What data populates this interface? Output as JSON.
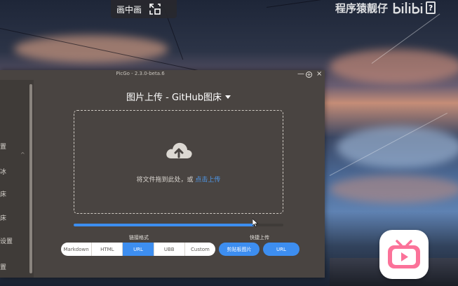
{
  "overlay": {
    "pip_label": "画中画",
    "watermark": "程序猿靓仔",
    "watermark_logo": "bilibili",
    "bili_badge": "?"
  },
  "window": {
    "title": "PicGo - 2.3.0-beta.6",
    "controls": {
      "minimize": "—",
      "maximize": "+",
      "close": "×"
    }
  },
  "sidebar": {
    "items": [
      {
        "label": "置"
      },
      {
        "label": "冰"
      },
      {
        "label": "床"
      },
      {
        "label": "床"
      },
      {
        "label": "设置"
      },
      {
        "label": "置"
      }
    ],
    "expanded_chevron": "^"
  },
  "main": {
    "heading": "图片上传 - GitHub图床",
    "drop_text": "将文件拖到此处，或 ",
    "drop_link": "点击上传",
    "progress": 0.86,
    "link_format_title": "链接格式",
    "link_formats": [
      "Markdown",
      "HTML",
      "URL",
      "UBB",
      "Custom"
    ],
    "active_format": "URL",
    "quick_upload_title": "快捷上传",
    "quick_buttons": [
      "剪贴板图片",
      "URL"
    ]
  },
  "colors": {
    "accent": "#3d8ef0",
    "window_bg": "#494441",
    "sidebar_bg": "#3f3b38",
    "link": "#4f9bf0"
  }
}
